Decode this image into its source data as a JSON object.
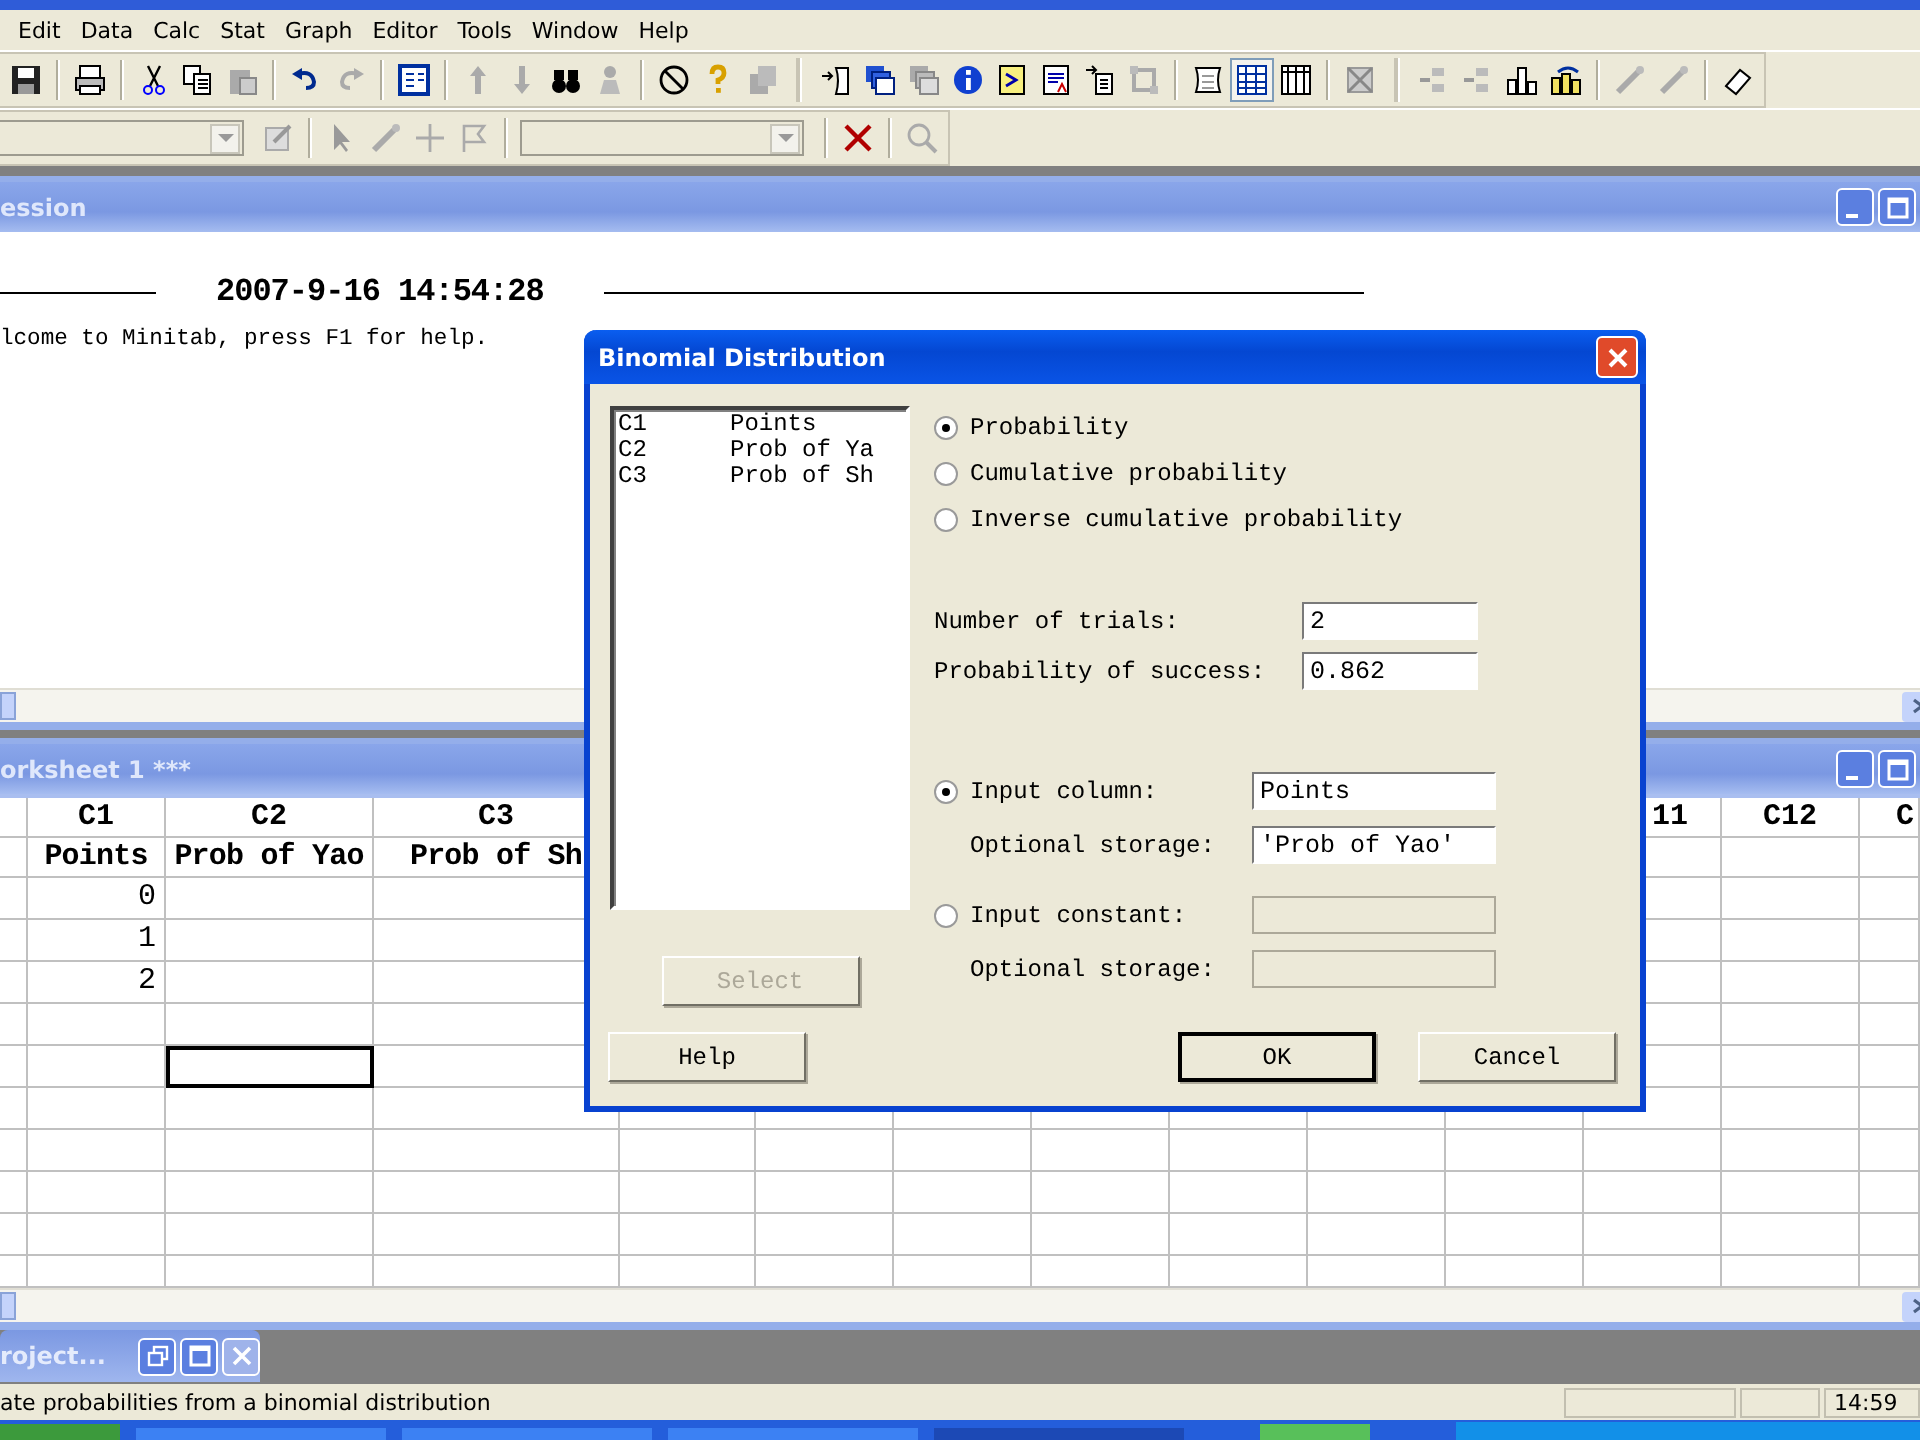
{
  "menu": [
    "Edit",
    "Data",
    "Calc",
    "Stat",
    "Graph",
    "Editor",
    "Tools",
    "Window",
    "Help"
  ],
  "session": {
    "title": "ession",
    "timestamp": "2007-9-16 14:54:28",
    "lines": [
      "lcome to Minitab, press F1 for help."
    ]
  },
  "worksheet": {
    "title": "orksheet 1 ***",
    "columns": [
      {
        "header": "C1",
        "name": "Points"
      },
      {
        "header": "C2",
        "name": "Prob of Yao"
      },
      {
        "header": "C3",
        "name": "Prob of Sh"
      },
      {},
      {},
      {},
      {},
      {},
      {},
      {},
      {
        "header": "11"
      },
      {
        "header": "C12"
      },
      {
        "header": "C"
      }
    ],
    "rows": [
      {
        "c1": "0",
        "selected": false
      },
      {
        "c1": "1",
        "selected": false
      },
      {
        "c1": "2",
        "selected": false
      },
      {
        "selected": false
      },
      {
        "selected": true
      },
      {
        "selected": false
      },
      {
        "selected": false
      },
      {
        "selected": false
      },
      {
        "selected": false
      },
      {
        "selected": false
      }
    ]
  },
  "project_window": {
    "title": "roject..."
  },
  "dialog": {
    "title": "Binomial Distribution",
    "column_list": [
      {
        "id": "C1",
        "name": "Points"
      },
      {
        "id": "C2",
        "name": "Prob of Ya"
      },
      {
        "id": "C3",
        "name": "Prob of Sh"
      }
    ],
    "modes": [
      {
        "label": "Probability",
        "selected": true
      },
      {
        "label": "Cumulative probability",
        "selected": false
      },
      {
        "label": "Inverse cumulative probability",
        "selected": false
      }
    ],
    "params": [
      {
        "label": "Number of trials:",
        "value": "2"
      },
      {
        "label": "Probability of success:",
        "value": "0.862"
      }
    ],
    "inputs": [
      {
        "label": "Input column:",
        "selected": true,
        "disabled": false,
        "value": "Points",
        "storage_label": "Optional storage:",
        "storage_value": "'Prob of Yao'"
      },
      {
        "label": "Input constant:",
        "selected": false,
        "disabled": true,
        "storage_label": "Optional storage:"
      }
    ],
    "select_button": {
      "label": "Select",
      "disabled": true
    },
    "buttons": [
      {
        "label": "Help",
        "default": false
      },
      {
        "label": "OK",
        "default": true
      },
      {
        "label": "Cancel",
        "default": false
      }
    ]
  },
  "status_bar": {
    "text": "ate probabilities from a binomial distribution",
    "clock": "14:59"
  }
}
